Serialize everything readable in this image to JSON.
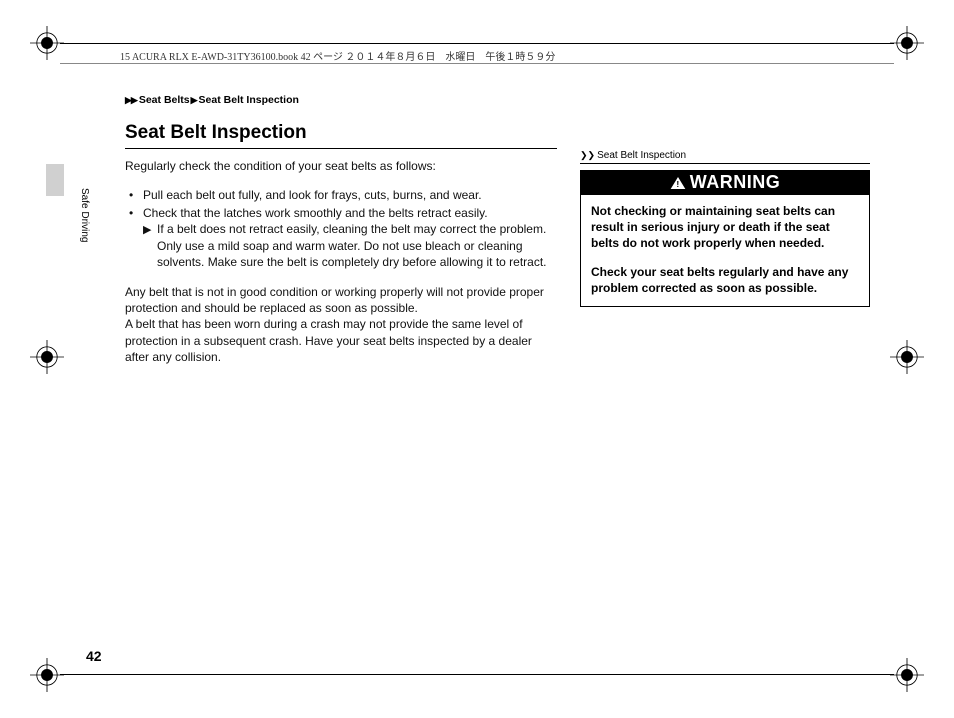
{
  "doc_header": "15 ACURA RLX E-AWD-31TY36100.book  42 ページ  ２０１４年８月６日　水曜日　午後１時５９分",
  "breadcrumb": {
    "level1": "Seat Belts",
    "level2": "Seat Belt Inspection"
  },
  "section_tab": "Safe Driving",
  "main": {
    "title": "Seat Belt Inspection",
    "intro": "Regularly check the condition of your seat belts as follows:",
    "bullets": [
      "Pull each belt out fully, and look for frays, cuts, burns, and wear.",
      "Check that the latches work smoothly and the belts retract easily."
    ],
    "sub": "If a belt does not retract easily, cleaning the belt may correct the problem. Only use a mild soap and warm water. Do not use bleach or cleaning solvents. Make sure the belt is completely dry before allowing it to retract.",
    "para": "Any belt that is not in good condition or working properly will not provide proper protection and should be replaced as soon as possible.\nA belt that has been worn during a crash may not provide the same level of protection in a subsequent crash. Have your seat belts inspected by a dealer after any collision."
  },
  "sidebar": {
    "ref": "Seat Belt Inspection",
    "warning_label": "WARNING",
    "warning_p1": "Not checking or maintaining seat belts can result in serious injury or death if the seat belts do not work properly when needed.",
    "warning_p2": "Check your seat belts regularly and have any problem corrected as soon as possible."
  },
  "page_number": "42"
}
